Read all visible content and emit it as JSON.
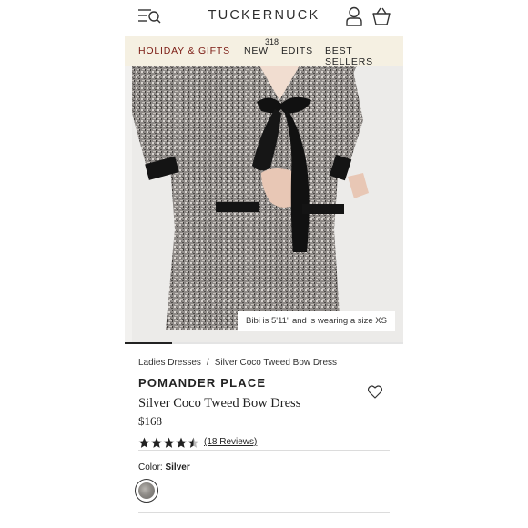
{
  "header": {
    "logo": "TUCKERNUCK"
  },
  "nav": {
    "items": [
      {
        "label": "HOLIDAY & GIFTS"
      },
      {
        "label": "NEW",
        "badge": "318"
      },
      {
        "label": "EDITS"
      },
      {
        "label": "BEST SELLERS"
      }
    ]
  },
  "hero": {
    "caption": "Bibi is 5'11\" and is wearing a size XS",
    "carousel_progress": 0.17
  },
  "product": {
    "breadcrumb": [
      "Ladies Dresses",
      "Silver Coco Tweed Bow Dress"
    ],
    "brand": "POMANDER PLACE",
    "name": "Silver Coco Tweed Bow Dress",
    "price": "$168",
    "rating": 4.5,
    "reviews": "(18 Reviews)",
    "color_label": "Color:",
    "color_value": "Silver"
  },
  "colors": {
    "accent": "#7a1a12",
    "nav_bg": "#f5f0e2"
  }
}
